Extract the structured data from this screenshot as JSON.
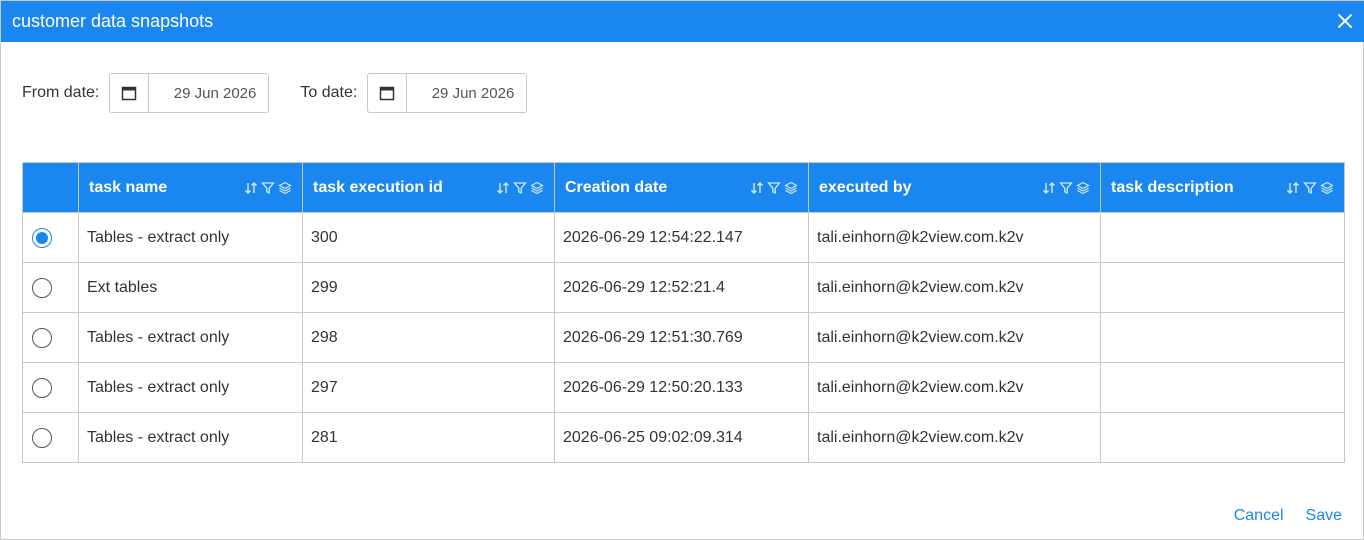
{
  "dialog": {
    "title": "customer data snapshots",
    "close_icon": "close-icon"
  },
  "filters": {
    "from_label": "From date:",
    "from_value": "29 Jun 2026",
    "to_label": "To date:",
    "to_value": "29 Jun 2026",
    "calendar_icon": "calendar-icon"
  },
  "table": {
    "columns": [
      {
        "label": "task name"
      },
      {
        "label": "task execution id"
      },
      {
        "label": "Creation date"
      },
      {
        "label": "executed by"
      },
      {
        "label": "task description"
      }
    ],
    "column_icons": [
      "sort-icon",
      "filter-icon",
      "layers-icon"
    ],
    "rows": [
      {
        "selected": true,
        "task_name": "Tables - extract only",
        "execution_id": "300",
        "creation_date": "2026-06-29 12:54:22.147",
        "executed_by": "tali.einhorn@k2view.com.k2v",
        "description": ""
      },
      {
        "selected": false,
        "task_name": "Ext tables",
        "execution_id": "299",
        "creation_date": "2026-06-29 12:52:21.4",
        "executed_by": "tali.einhorn@k2view.com.k2v",
        "description": ""
      },
      {
        "selected": false,
        "task_name": "Tables - extract only",
        "execution_id": "298",
        "creation_date": "2026-06-29 12:51:30.769",
        "executed_by": "tali.einhorn@k2view.com.k2v",
        "description": ""
      },
      {
        "selected": false,
        "task_name": "Tables - extract only",
        "execution_id": "297",
        "creation_date": "2026-06-29 12:50:20.133",
        "executed_by": "tali.einhorn@k2view.com.k2v",
        "description": ""
      },
      {
        "selected": false,
        "task_name": "Tables - extract only",
        "execution_id": "281",
        "creation_date": "2026-06-25 09:02:09.314",
        "executed_by": "tali.einhorn@k2view.com.k2v",
        "description": ""
      }
    ]
  },
  "footer": {
    "cancel_label": "Cancel",
    "save_label": "Save"
  },
  "colors": {
    "accent": "#1a87f0",
    "border": "#c8c8c8",
    "text": "#333333"
  }
}
